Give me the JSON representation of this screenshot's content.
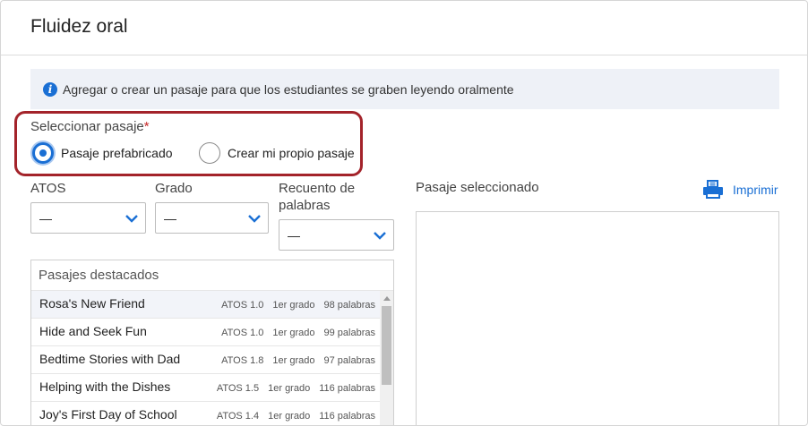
{
  "dialog": {
    "title": "Fluidez oral"
  },
  "info": {
    "text": "Agregar o crear un pasaje para que los estudiantes se graben leyendo oralmente"
  },
  "passage_select": {
    "label": "Seleccionar pasaje",
    "required_mark": "*",
    "options": [
      {
        "label": "Pasaje prefabricado",
        "checked": true
      },
      {
        "label": "Crear mi propio pasaje",
        "checked": false
      }
    ]
  },
  "filters": {
    "atos": {
      "label": "ATOS",
      "value": "—"
    },
    "grade": {
      "label": "Grado",
      "value": "—"
    },
    "word_count": {
      "label_line1": "Recuento de",
      "label_line2": "palabras",
      "value": "—"
    }
  },
  "featured": {
    "header": "Pasajes destacados",
    "rows": [
      {
        "title": "Rosa's New Friend",
        "atos": "ATOS 1.0",
        "grade": "1er grado",
        "words": "98 palabras"
      },
      {
        "title": "Hide and Seek Fun",
        "atos": "ATOS 1.0",
        "grade": "1er grado",
        "words": "99 palabras"
      },
      {
        "title": "Bedtime Stories with Dad",
        "atos": "ATOS 1.8",
        "grade": "1er grado",
        "words": "97 palabras"
      },
      {
        "title": "Helping with the Dishes",
        "atos": "ATOS 1.5",
        "grade": "1er grado",
        "words": "116 palabras"
      },
      {
        "title": "Joy's First Day of School",
        "atos": "ATOS 1.4",
        "grade": "1er grado",
        "words": "116 palabras"
      }
    ]
  },
  "selected": {
    "label": "Pasaje seleccionado",
    "print_label": "Imprimir"
  },
  "colors": {
    "accent": "#1a6fd4",
    "highlight_border": "#a3232a",
    "info_bg": "#eef1f7"
  }
}
